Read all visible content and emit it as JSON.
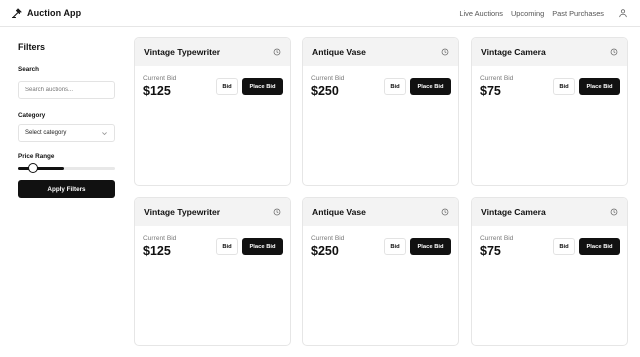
{
  "header": {
    "app_title": "Auction App",
    "brand_icon": "gavel-icon",
    "nav": [
      "Live Auctions",
      "Upcoming",
      "Past Purchases"
    ],
    "user_icon": "user-icon"
  },
  "filters": {
    "title": "Filters",
    "search_label": "Search",
    "search_placeholder": "Search auctions...",
    "category_label": "Category",
    "category_value": "Select category",
    "price_label": "Price Range",
    "price_level": 0.12,
    "apply_label": "Apply Filters"
  },
  "cards": [
    {
      "title": "Vintage Typewriter",
      "bid_label": "Current Bid",
      "bid": "$125",
      "bid_button": "Bid",
      "place_button": "Place Bid"
    },
    {
      "title": "Antique Vase",
      "bid_label": "Current Bid",
      "bid": "$250",
      "bid_button": "Bid",
      "place_button": "Place Bid"
    },
    {
      "title": "Vintage Camera",
      "bid_label": "Current Bid",
      "bid": "$75",
      "bid_button": "Bid",
      "place_button": "Place Bid"
    },
    {
      "title": "Vintage Typewriter",
      "bid_label": "Current Bid",
      "bid": "$125",
      "bid_button": "Bid",
      "place_button": "Place Bid"
    },
    {
      "title": "Antique Vase",
      "bid_label": "Current Bid",
      "bid": "$250",
      "bid_button": "Bid",
      "place_button": "Place Bid"
    },
    {
      "title": "Vintage Camera",
      "bid_label": "Current Bid",
      "bid": "$75",
      "bid_button": "Bid",
      "place_button": "Place Bid"
    }
  ]
}
